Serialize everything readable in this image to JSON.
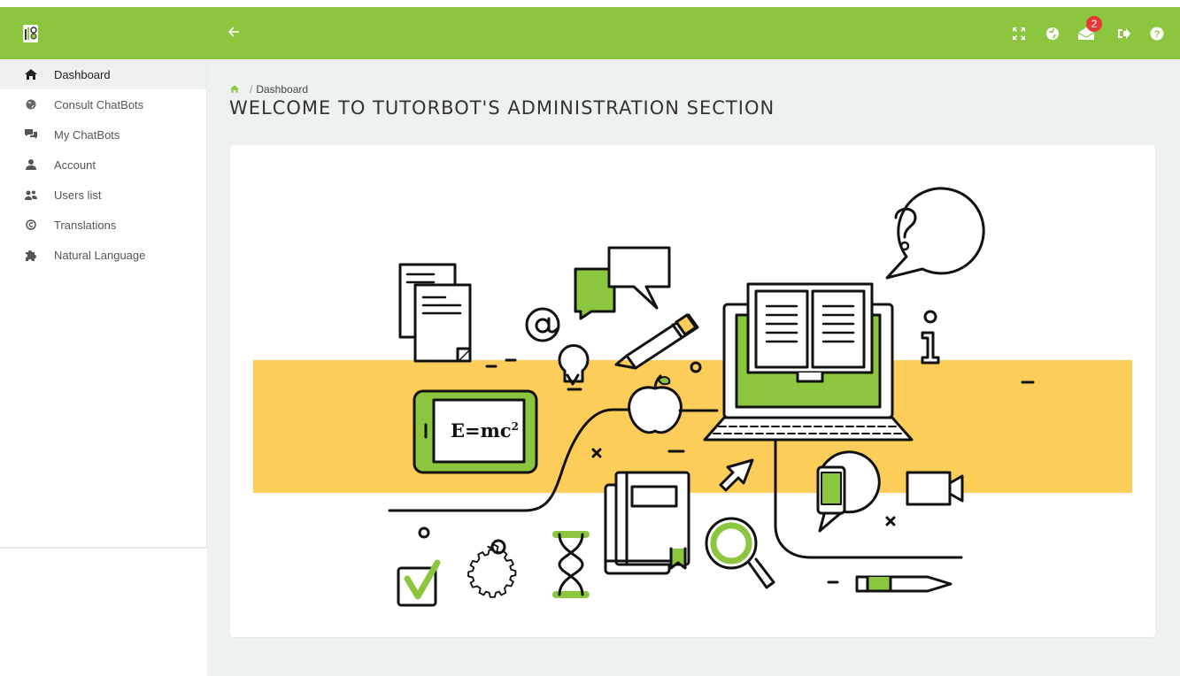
{
  "colors": {
    "brand": "#8cc63f",
    "band": "#fdcd59",
    "badge": "#e53935"
  },
  "topbar": {
    "back_icon": "arrow-left-icon",
    "icons": [
      "fullscreen-icon",
      "globe-icon",
      "envelope-icon",
      "sign-out-icon",
      "help-icon"
    ],
    "notification_count": "2"
  },
  "sidebar": {
    "items": [
      {
        "label": "Dashboard",
        "icon": "home-icon",
        "active": true
      },
      {
        "label": "Consult ChatBots",
        "icon": "globe-icon"
      },
      {
        "label": "My ChatBots",
        "icon": "comments-icon"
      },
      {
        "label": "Account",
        "icon": "user-icon"
      },
      {
        "label": "Users list",
        "icon": "users-icon"
      },
      {
        "label": "Translations",
        "icon": "copyright-icon"
      },
      {
        "label": "Natural Language",
        "icon": "puzzle-icon"
      }
    ]
  },
  "breadcrumb": {
    "separator": "/",
    "current": "Dashboard"
  },
  "page": {
    "title": "WELCOME TO TUTORBOT'S ADMINISTRATION SECTION"
  },
  "illustration": {
    "formula": "E=mc",
    "formula_sup": "2"
  }
}
